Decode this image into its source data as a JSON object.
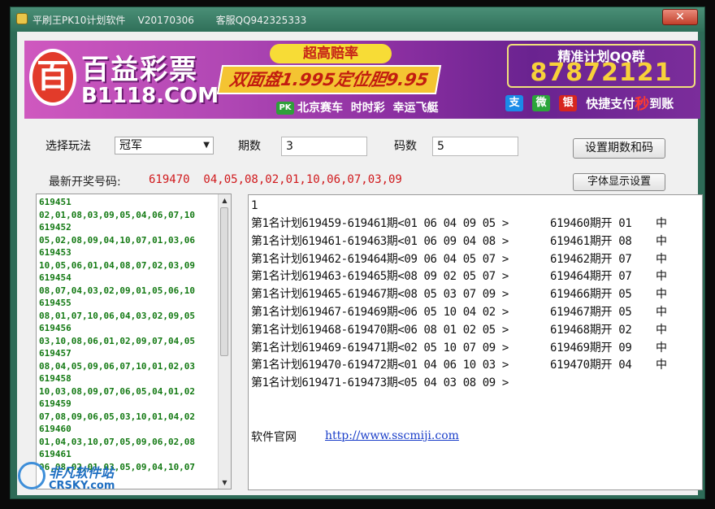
{
  "window": {
    "title": "平刷王PK10计划软件    V20170306       客服QQ942325333",
    "close_glyph": "✕"
  },
  "banner": {
    "logo_glyph": "百",
    "brand_name": "百益彩票",
    "domain": "B1118.COM",
    "tagline": "超高赔率",
    "promo": "双面盘1.995定位胆9.95",
    "pk_badge": "PK",
    "games": "北京赛车  时时彩  幸运飞艇",
    "qq_title": "精准计划QQ群",
    "qq_number": "87872121",
    "pay_icons": [
      {
        "name": "alipay-icon",
        "glyph": "支",
        "color": "#1a8be8"
      },
      {
        "name": "wechat-icon",
        "glyph": "微",
        "color": "#2ba53a"
      },
      {
        "name": "unionpay-icon",
        "glyph": "银",
        "color": "#d7261e"
      }
    ],
    "pay_text": "快捷支付",
    "pay_highlight": "秒",
    "pay_suffix": "到账"
  },
  "controls": {
    "play_label": "选择玩法",
    "play_value": "冠军",
    "period_label": "期数",
    "period_value": "3",
    "code_label": "码数",
    "code_value": "5",
    "set_button": "设置期数和码",
    "font_button": "字体显示设置"
  },
  "latest": {
    "label": "最新开奖号码:",
    "value": "619470  04,05,08,02,01,10,06,07,03,09"
  },
  "history": [
    "619451",
    "02,01,08,03,09,05,04,06,07,10",
    "619452",
    "05,02,08,09,04,10,07,01,03,06",
    "619453",
    "10,05,06,01,04,08,07,02,03,09",
    "619454",
    "08,07,04,03,02,09,01,05,06,10",
    "619455",
    "08,01,07,10,06,04,03,02,09,05",
    "619456",
    "03,10,08,06,01,02,09,07,04,05",
    "619457",
    "08,04,05,09,06,07,10,01,02,03",
    "619458",
    "10,03,08,09,07,06,05,04,01,02",
    "619459",
    "07,08,09,06,05,03,10,01,04,02",
    "619460",
    "01,04,03,10,07,05,09,06,02,08",
    "619461",
    "06,08,02,01,03,05,09,04,10,07"
  ],
  "plans": {
    "first_line": "1",
    "rows": [
      {
        "plan": "第1名计划619459-619461期<01 06 04 09 05 >",
        "open": "619460期开 01",
        "result": "中"
      },
      {
        "plan": "第1名计划619461-619463期<01 06 09 04 08 >",
        "open": "619461期开 08",
        "result": "中"
      },
      {
        "plan": "第1名计划619462-619464期<09 06 04 05 07 >",
        "open": "619462期开 07",
        "result": "中"
      },
      {
        "plan": "第1名计划619463-619465期<08 09 02 05 07 >",
        "open": "619464期开 07",
        "result": "中"
      },
      {
        "plan": "第1名计划619465-619467期<08 05 03 07 09 >",
        "open": "619466期开 05",
        "result": "中"
      },
      {
        "plan": "第1名计划619467-619469期<06 05 10 04 02 >",
        "open": "619467期开 05",
        "result": "中"
      },
      {
        "plan": "第1名计划619468-619470期<06 08 01 02 05 >",
        "open": "619468期开 02",
        "result": "中"
      },
      {
        "plan": "第1名计划619469-619471期<02 05 10 07 09 >",
        "open": "619469期开 09",
        "result": "中"
      },
      {
        "plan": "第1名计划619470-619472期<01 04 06 10 03 >",
        "open": "619470期开 04",
        "result": "中"
      },
      {
        "plan": "第1名计划619471-619473期<05 04 03 08 09 >",
        "open": "",
        "result": ""
      }
    ],
    "site_label": "软件官网",
    "site_url": "http://www.sscmiji.com"
  },
  "watermark": {
    "name": "非凡软件站",
    "domain": "CRSKY.com"
  }
}
